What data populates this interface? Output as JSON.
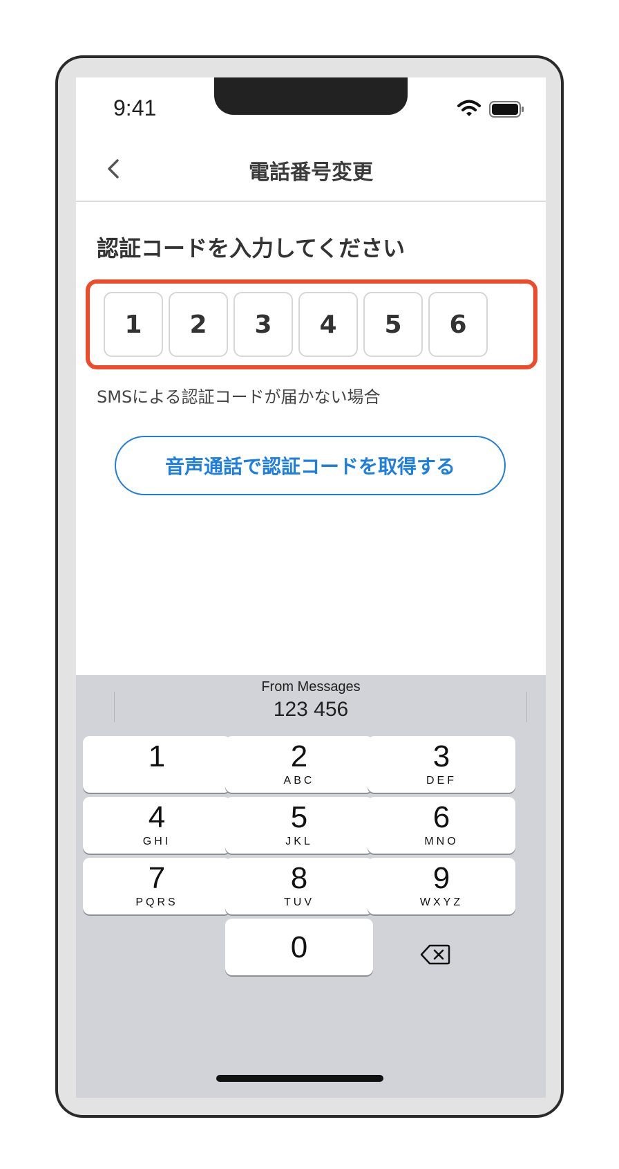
{
  "status_bar": {
    "time": "9:41"
  },
  "nav": {
    "title": "電話番号変更"
  },
  "verification": {
    "prompt": "認証コードを入力してください",
    "digits": [
      "1",
      "2",
      "3",
      "4",
      "5",
      "6"
    ],
    "help_text": "SMSによる認証コードが届かない場合",
    "voice_button_label": "音声通話で認証コードを取得する"
  },
  "keyboard": {
    "suggestion_source": "From Messages",
    "suggestion_code": "123 456",
    "keys": [
      {
        "digit": "1",
        "letters": ""
      },
      {
        "digit": "2",
        "letters": "ABC"
      },
      {
        "digit": "3",
        "letters": "DEF"
      },
      {
        "digit": "4",
        "letters": "GHI"
      },
      {
        "digit": "5",
        "letters": "JKL"
      },
      {
        "digit": "6",
        "letters": "MNO"
      },
      {
        "digit": "7",
        "letters": "PQRS"
      },
      {
        "digit": "8",
        "letters": "TUV"
      },
      {
        "digit": "9",
        "letters": "WXYZ"
      },
      {
        "digit": "0",
        "letters": ""
      }
    ]
  },
  "colors": {
    "accent": "#1e7ee0",
    "highlight": "#ee4b2b",
    "keyboard_bg": "#d2d3d8"
  },
  "icons": {
    "back": "chevron-left-icon",
    "wifi": "wifi-icon",
    "battery": "battery-icon",
    "delete": "backspace-icon"
  }
}
